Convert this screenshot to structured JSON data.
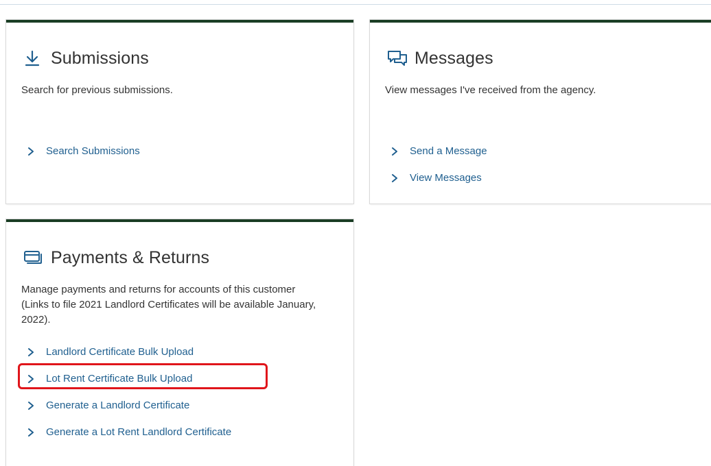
{
  "cards": {
    "submissions": {
      "title": "Submissions",
      "icon": "download-icon",
      "description": "Search for previous submissions.",
      "links": [
        {
          "label": "Search Submissions"
        }
      ]
    },
    "messages": {
      "title": "Messages",
      "icon": "chat-icon",
      "description": "View messages I've received from the agency.",
      "links": [
        {
          "label": "Send a Message"
        },
        {
          "label": "View Messages"
        }
      ]
    },
    "payments": {
      "title": "Payments & Returns",
      "icon": "payments-icon",
      "description": "Manage payments and returns for accounts of this customer (Links to file 2021 Landlord Certificates will be available January, 2022).",
      "links": [
        {
          "label": "Landlord Certificate Bulk Upload"
        },
        {
          "label": "Lot Rent Certificate Bulk Upload",
          "highlighted": true
        },
        {
          "label": "Generate a Landlord Certificate"
        },
        {
          "label": "Generate a Lot Rent Landlord Certificate"
        }
      ]
    }
  },
  "colors": {
    "card_accent": "#1a3d24",
    "link": "#1f5f8f",
    "icon": "#1f5f8f",
    "highlight": "#e0151b"
  }
}
